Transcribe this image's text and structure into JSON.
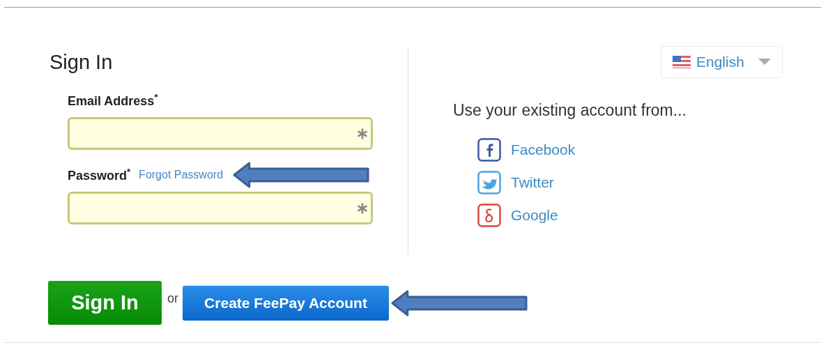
{
  "title": "Sign In",
  "fields": [
    {
      "label": "Email Address$^{*}$",
      "required": true
    },
    {
      "label": "Password$^{*}$",
      "link": "Forgot Password",
      "required": true
    }
  ],
  "language": {
    "label": "English"
  },
  "social": {
    "heading": "Use your existing account from...",
    "providers": [
      {
        "kind": "facebook",
        "label": "Facebook"
      },
      {
        "kind": "twitter",
        "label": "Twitter"
      },
      {
        "kind": "google",
        "label": "Google"
      }
    ]
  },
  "actions": {
    "primary": "Sign In",
    "separator": "or",
    "secondary": "Create FeePay Account"
  }
}
